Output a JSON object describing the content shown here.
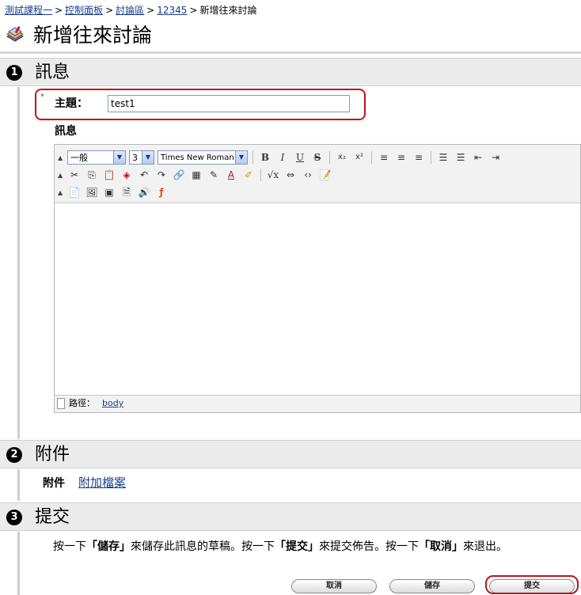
{
  "breadcrumb": {
    "items": [
      "測試課程一",
      "控制面板",
      "討論區",
      "12345"
    ],
    "current": "新增往來討論",
    "separator": ">"
  },
  "page_title": "新增往來討論",
  "steps": [
    {
      "number": "1",
      "title": "訊息"
    },
    {
      "number": "2",
      "title": "附件"
    },
    {
      "number": "3",
      "title": "提交"
    }
  ],
  "subject": {
    "label": "主題：",
    "value": "test1",
    "required_mark": "*"
  },
  "message": {
    "label": "訊息"
  },
  "editor": {
    "format_select": "一般",
    "size_select": "3",
    "font_select": "Times New Roman",
    "status_label": "路徑：",
    "status_path": "body"
  },
  "attachments": {
    "label": "附件",
    "link": "附加檔案"
  },
  "submit": {
    "instructions_parts": [
      "按一下",
      "「儲存」",
      "來儲存此訊息的草稿。按一下",
      "「提交」",
      "來提交佈告。按一下",
      "「取消」",
      "來退出。"
    ],
    "cancel_label": "取消",
    "save_label": "儲存",
    "submit_label": "提交"
  },
  "colors": {
    "highlight": "#c0131b",
    "link": "#1a3d8f",
    "step_header_bg": "#ebebeb"
  }
}
